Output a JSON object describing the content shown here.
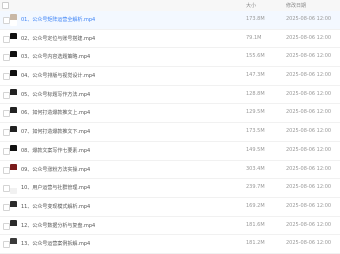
{
  "header": {
    "name": "",
    "size": "大小",
    "date": "修改日期"
  },
  "files": [
    {
      "index": "01",
      "title": "公众号矩阵运营全解析.mp4",
      "size": "173.8M",
      "date": "2025-08-06 12:00",
      "selected": true,
      "thumb_top": "#c9b8a6",
      "thumb_bot": "#ffffff"
    },
    {
      "index": "02",
      "title": "公众号定位与账号搭建.mp4",
      "size": "79.1M",
      "date": "2025-08-06 12:00",
      "selected": false,
      "thumb_top": "#111111",
      "thumb_bot": "#ffffff"
    },
    {
      "index": "03",
      "title": "公众号内容选题策略.mp4",
      "size": "155.6M",
      "date": "2025-08-06 12:00",
      "selected": false,
      "thumb_top": "#111111",
      "thumb_bot": "#ffffff"
    },
    {
      "index": "04",
      "title": "公众号排版与视觉设计.mp4",
      "size": "147.3M",
      "date": "2025-08-06 12:00",
      "selected": false,
      "thumb_top": "#111111",
      "thumb_bot": "#ffffff"
    },
    {
      "index": "05",
      "title": "公众号标题写作方法.mp4",
      "size": "128.8M",
      "date": "2025-08-06 12:00",
      "selected": false,
      "thumb_top": "#222222",
      "thumb_bot": "#ffffff"
    },
    {
      "index": "06",
      "title": "如何打造爆款推文上.mp4",
      "size": "129.5M",
      "date": "2025-08-06 12:00",
      "selected": false,
      "thumb_top": "#222222",
      "thumb_bot": "#ffffff"
    },
    {
      "index": "07",
      "title": "如何打造爆款推文下.mp4",
      "size": "173.5M",
      "date": "2025-08-06 12:00",
      "selected": false,
      "thumb_top": "#222222",
      "thumb_bot": "#ffffff"
    },
    {
      "index": "08",
      "title": "爆款文案写作七要素.mp4",
      "size": "149.5M",
      "date": "2025-08-06 12:00",
      "selected": false,
      "thumb_top": "#111111",
      "thumb_bot": "#ffffff"
    },
    {
      "index": "09",
      "title": "公众号涨粉方法实操.mp4",
      "size": "303.4M",
      "date": "2025-08-06 12:00",
      "selected": false,
      "thumb_top": "#7a1c1c",
      "thumb_bot": "#ffffff"
    },
    {
      "index": "10",
      "title": "用户运营与社群管理.mp4",
      "size": "239.7M",
      "date": "2025-08-06 12:00",
      "selected": false,
      "thumb_top": "#ffffff",
      "thumb_bot": "#f1f1f1"
    },
    {
      "index": "11",
      "title": "公众号变现模式解析.mp4",
      "size": "169.2M",
      "date": "2025-08-06 12:00",
      "selected": false,
      "thumb_top": "#2b2b2b",
      "thumb_bot": "#ffffff"
    },
    {
      "index": "12",
      "title": "公众号数据分析与复盘.mp4",
      "size": "181.6M",
      "date": "2025-08-06 12:00",
      "selected": false,
      "thumb_top": "#2b2b2b",
      "thumb_bot": "#ffffff"
    },
    {
      "index": "13",
      "title": "公众号运营案例拆解.mp4",
      "size": "181.2M",
      "date": "2025-08-06 12:00",
      "selected": false,
      "thumb_top": "#3a3a3a",
      "thumb_bot": "#ffffff"
    }
  ]
}
